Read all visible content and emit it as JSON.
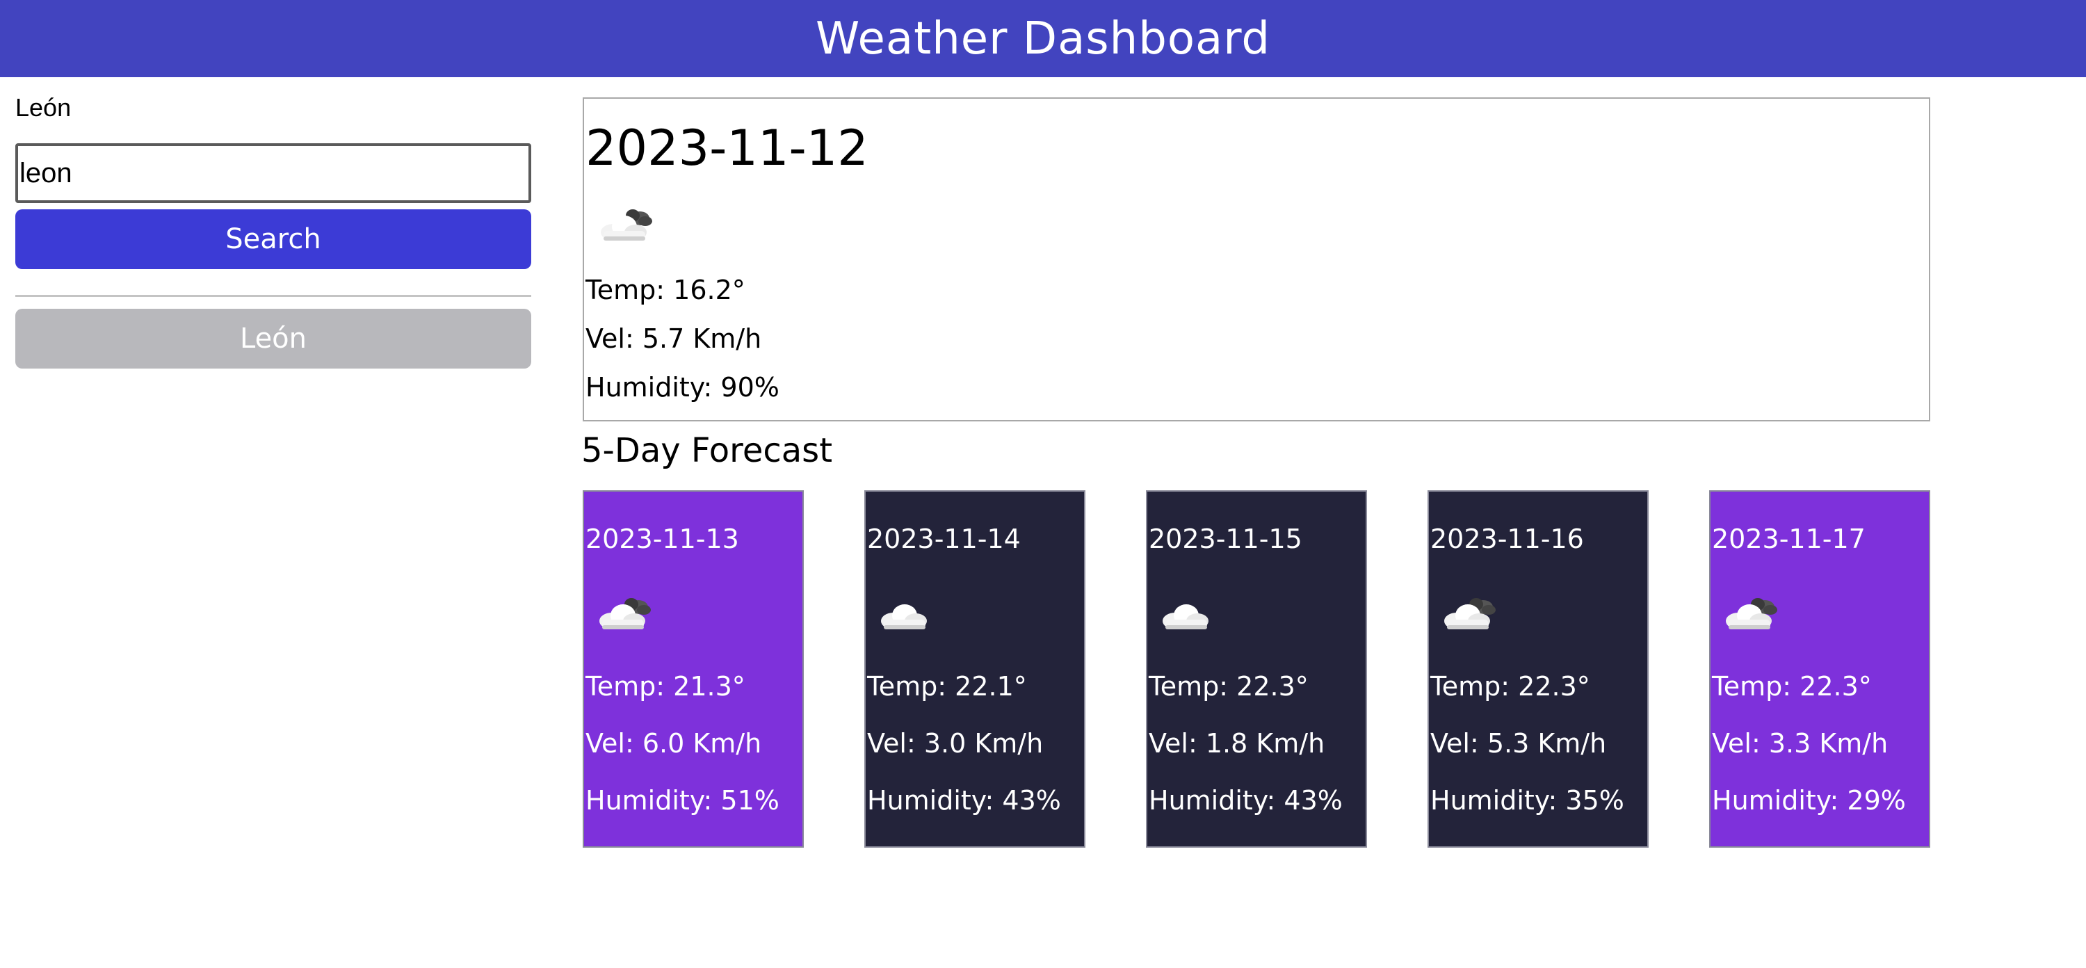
{
  "header": {
    "title": "Weather Dashboard"
  },
  "sidebar": {
    "city_label": "León",
    "search_value": "leon",
    "search_button": "Search",
    "history": [
      {
        "label": "León"
      }
    ]
  },
  "today": {
    "date": "2023-11-12",
    "icon": "partly-cloudy-icon",
    "temp": "Temp: 16.2°",
    "wind": "Vel: 5.7 Km/h",
    "humidity": "Humidity: 90%"
  },
  "forecast": {
    "title": "5-Day Forecast",
    "days": [
      {
        "date": "2023-11-13",
        "icon": "partly-cloudy-icon",
        "temp": "Temp: 21.3°",
        "wind": "Vel: 6.0 Km/h",
        "humidity": "Humidity: 51%",
        "color": "#7e31db"
      },
      {
        "date": "2023-11-14",
        "icon": "cloud-icon",
        "temp": "Temp: 22.1°",
        "wind": "Vel: 3.0 Km/h",
        "humidity": "Humidity: 43%",
        "color": "#23233a"
      },
      {
        "date": "2023-11-15",
        "icon": "cloud-icon",
        "temp": "Temp: 22.3°",
        "wind": "Vel: 1.8 Km/h",
        "humidity": "Humidity: 43%",
        "color": "#23233a"
      },
      {
        "date": "2023-11-16",
        "icon": "partly-cloudy-icon",
        "temp": "Temp: 22.3°",
        "wind": "Vel: 5.3 Km/h",
        "humidity": "Humidity: 35%",
        "color": "#23233a"
      },
      {
        "date": "2023-11-17",
        "icon": "partly-cloudy-icon",
        "temp": "Temp: 22.3°",
        "wind": "Vel: 3.3 Km/h",
        "humidity": "Humidity: 29%",
        "color": "#7e31db"
      }
    ]
  },
  "colors": {
    "header_bg": "#4244bf",
    "search_button_bg": "#3c3bd6",
    "history_button_bg": "#b8b8bc"
  }
}
